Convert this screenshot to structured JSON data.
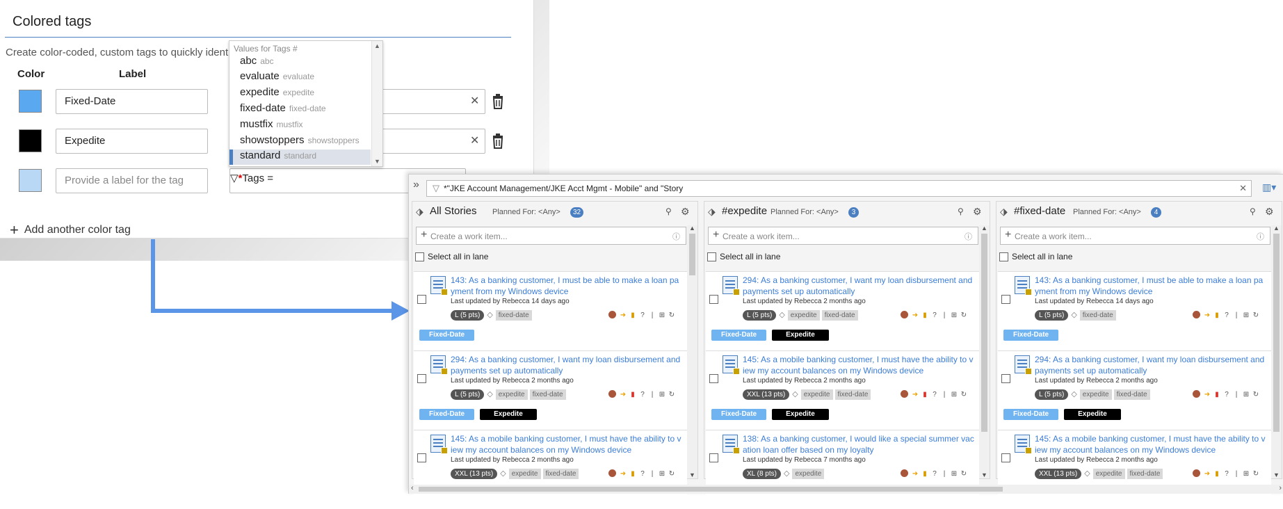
{
  "tags_panel": {
    "title": "Colored tags",
    "description": "Create color-coded, custom tags to quickly identif",
    "col_color": "Color",
    "col_label": "Label",
    "rows": [
      {
        "color": "#5aa9f0",
        "label": "Fixed-Date"
      },
      {
        "color": "#000000",
        "label": "Expedite"
      }
    ],
    "new_row": {
      "color": "#b8d8f6",
      "placeholder": "Provide a label for the tag"
    },
    "filter_label": "Tags =",
    "add_button": "Add another color tag"
  },
  "dropdown": {
    "header": "Values for Tags #",
    "items": [
      {
        "value": "abc",
        "sub": "abc"
      },
      {
        "value": "evaluate",
        "sub": "evaluate"
      },
      {
        "value": "expedite",
        "sub": "expedite"
      },
      {
        "value": "fixed-date",
        "sub": "fixed-date"
      },
      {
        "value": "mustfix",
        "sub": "mustfix"
      },
      {
        "value": "showstoppers",
        "sub": "showstoppers"
      },
      {
        "value": "standard",
        "sub": "standard"
      }
    ],
    "selected": "standard"
  },
  "board": {
    "filter": "*\"JKE Account Management/JKE Acct Mgmt - Mobile\" and \"Story",
    "lanes": [
      {
        "title": "All Stories",
        "planned": "Planned For: <Any>",
        "count": "32",
        "create_placeholder": "Create a work item...",
        "select_all": "Select all in lane",
        "cards": [
          {
            "title": "143: As a banking customer, I must be able to make a loan payment from my Windows device",
            "updated": "Last updated by Rebecca 14 days ago",
            "pts": "L (5 pts)",
            "chips": [
              "fixed-date"
            ],
            "tags": [
              "Fixed-Date"
            ]
          },
          {
            "title": "294: As a banking customer, I want my loan disbursement and payments set up automatically",
            "updated": "Last updated by Rebecca 2 months ago",
            "pts": "L (5 pts)",
            "chips": [
              "expedite",
              "fixed-date"
            ],
            "tags": [
              "Fixed-Date",
              "Expedite"
            ]
          },
          {
            "title": "145: As a mobile banking customer, I must have the ability to view my account balances on my Windows device",
            "updated": "Last updated by Rebecca 2 months ago",
            "pts": "XXL (13 pts)",
            "chips": [
              "expedite",
              "fixed-date"
            ],
            "tags": []
          }
        ]
      },
      {
        "title": "#expedite",
        "planned": "Planned For: <Any>",
        "count": "3",
        "create_placeholder": "Create a work item...",
        "select_all": "Select all in lane",
        "cards": [
          {
            "title": "294: As a banking customer, I want my loan disbursement and payments set up automatically",
            "updated": "Last updated by Rebecca 2 months ago",
            "pts": "L (5 pts)",
            "chips": [
              "expedite",
              "fixed-date"
            ],
            "tags": [
              "Fixed-Date",
              "Expedite"
            ]
          },
          {
            "title": "145: As a mobile banking customer, I must have the ability to view my account balances on my Windows device",
            "updated": "Last updated by Rebecca 2 months ago",
            "pts": "XXL (13 pts)",
            "chips": [
              "expedite",
              "fixed-date"
            ],
            "tags": [
              "Fixed-Date",
              "Expedite"
            ]
          },
          {
            "title": "138: As a banking customer, I would like a special summer vacation loan offer based on my loyalty",
            "updated": "Last updated by Rebecca 7 months ago",
            "pts": "XL (8 pts)",
            "chips": [
              "expedite"
            ],
            "tags": []
          }
        ]
      },
      {
        "title": "#fixed-date",
        "planned": "Planned For: <Any>",
        "count": "4",
        "create_placeholder": "Create a work item...",
        "select_all": "Select all in lane",
        "cards": [
          {
            "title": "143: As a banking customer, I must be able to make a loan payment from my Windows device",
            "updated": "Last updated by Rebecca 14 days ago",
            "pts": "L (5 pts)",
            "chips": [
              "fixed-date"
            ],
            "tags": [
              "Fixed-Date"
            ]
          },
          {
            "title": "294: As a banking customer, I want my loan disbursement and payments set up automatically",
            "updated": "Last updated by Rebecca 2 months ago",
            "pts": "L (5 pts)",
            "chips": [
              "expedite",
              "fixed-date"
            ],
            "tags": [
              "Fixed-Date",
              "Expedite"
            ]
          },
          {
            "title": "145: As a mobile banking customer, I must have the ability to view my account balances on my Windows device",
            "updated": "Last updated by Rebecca 2 months ago",
            "pts": "XXL (13 pts)",
            "chips": [
              "expedite",
              "fixed-date"
            ],
            "tags": []
          }
        ]
      }
    ]
  },
  "colors": {
    "accent": "#4a7fc1",
    "link": "#3b7dd8",
    "fixed_date_tag": "#6fb3f0",
    "expedite_tag": "#000000",
    "arrow": "#5b95e8"
  }
}
